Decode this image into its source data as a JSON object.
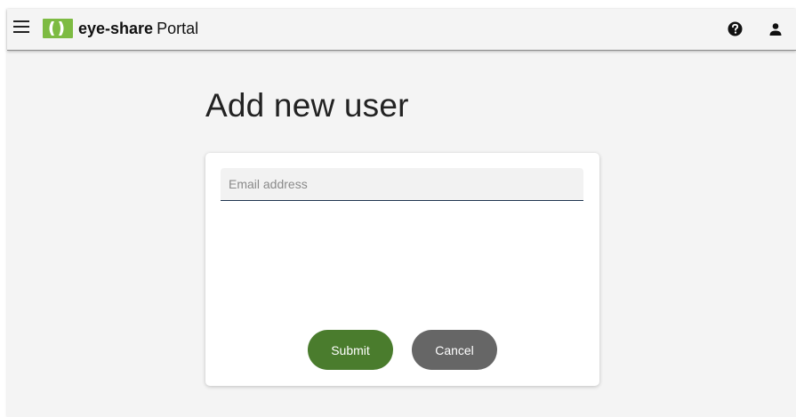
{
  "header": {
    "brand_name": "eye-share",
    "brand_suffix": "Portal",
    "menu_icon": "hamburger-menu-icon",
    "help_icon": "question-circle-icon",
    "user_icon": "person-icon",
    "logo_color": "#7dbb42"
  },
  "page": {
    "title": "Add new user"
  },
  "form": {
    "email_placeholder": "Email address",
    "email_value": "",
    "submit_label": "Submit",
    "cancel_label": "Cancel"
  },
  "colors": {
    "submit_button": "#4a7c2d",
    "cancel_button": "#666666",
    "field_underline": "#1f3550"
  }
}
